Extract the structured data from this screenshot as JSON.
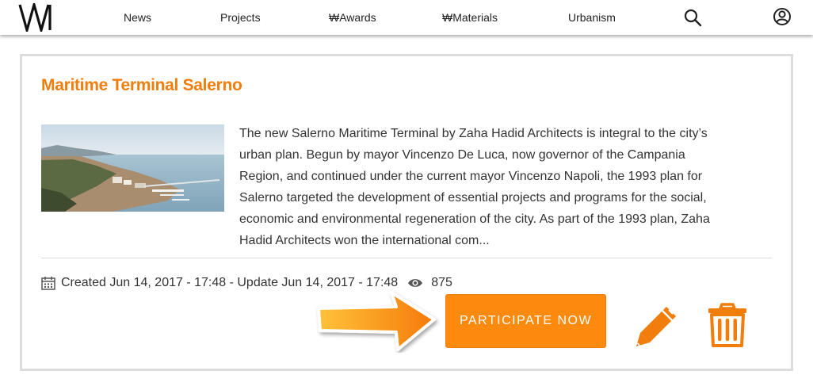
{
  "nav": {
    "logo_icon": "wa-logo-icon",
    "items": [
      {
        "label": "News"
      },
      {
        "label": "Projects"
      },
      {
        "label": "₩Awards"
      },
      {
        "label": "₩Materials"
      },
      {
        "label": "Urbanism"
      }
    ],
    "search_icon": "search-icon",
    "account_icon": "user-circle-icon"
  },
  "card": {
    "title": "Maritime Terminal Salerno",
    "description": "The new Salerno Maritime Terminal by Zaha Hadid Architects is integral to the city’s urban plan. Begun by mayor Vincenzo De Luca, now governor of the Campania Region, and continued under the current mayor Vincenzo Napoli, the 1993 plan for Salerno targeted the development of essential projects and programs for the social, economic and environmental regeneration of the city. As part of the 1993 plan, Zaha Hadid Architects won the international com...",
    "meta": "Created Jun 14, 2017 - 17:48 - Update Jun 14, 2017 - 17:48",
    "views": "875",
    "participate_label": "PARTICIPATE NOW"
  },
  "colors": {
    "accent": "#f07d0c",
    "button": "#fb8a0f",
    "border": "#dcdcdc"
  }
}
